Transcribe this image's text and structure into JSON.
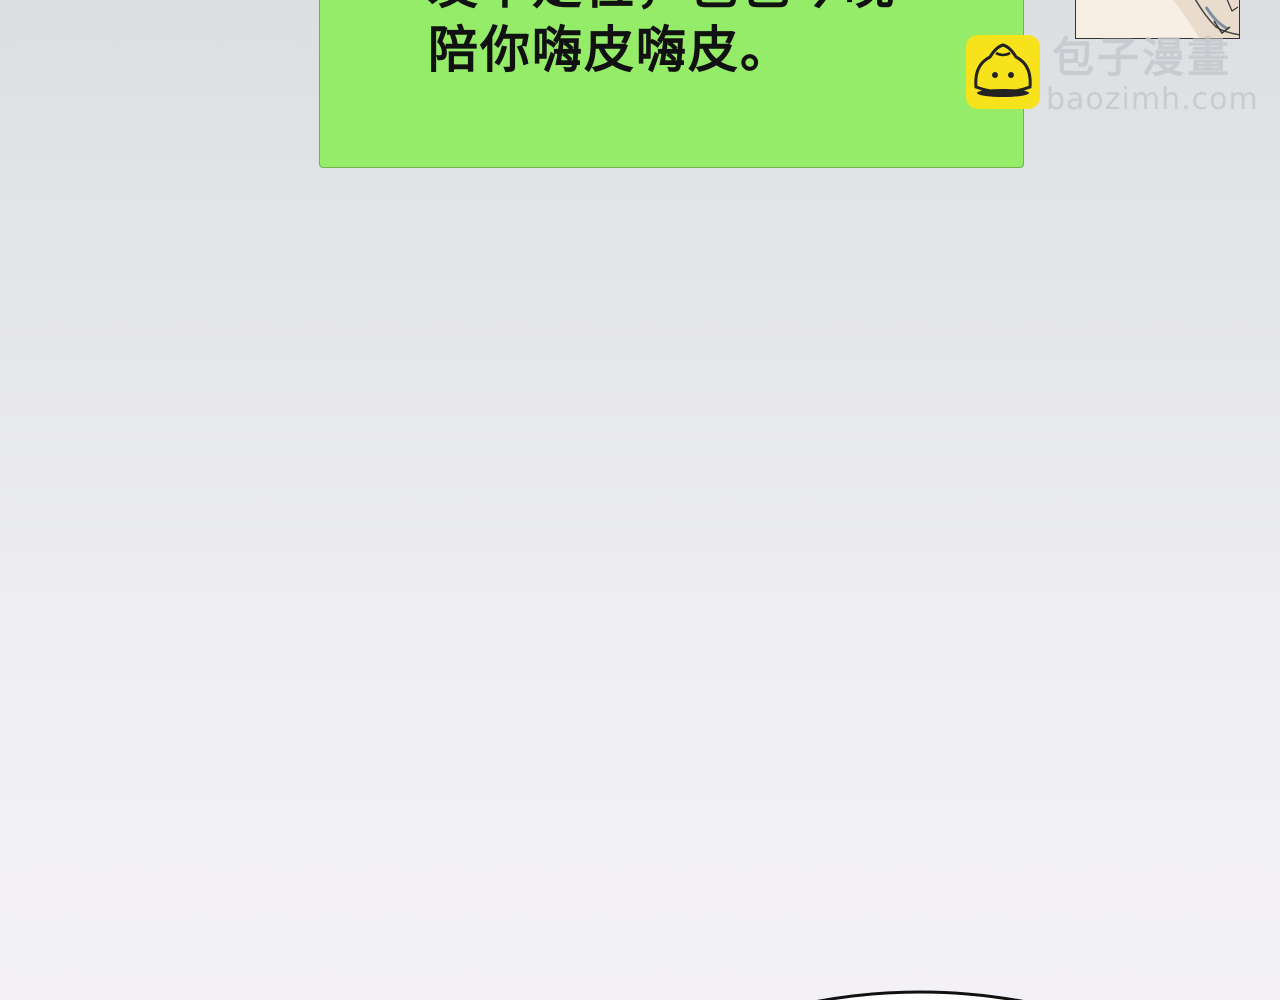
{
  "message": {
    "line_1": "发个定位，爸爸今晚",
    "line_2": "陪你嗨皮嗨皮。"
  },
  "watermark": {
    "name": "包子漫畫",
    "domain": "baozimh.com"
  },
  "colors": {
    "bubble": "#95ec69",
    "logo": "#f8e21c",
    "background_top": "#dcdfe2",
    "background_bottom": "#f3f1f5"
  }
}
